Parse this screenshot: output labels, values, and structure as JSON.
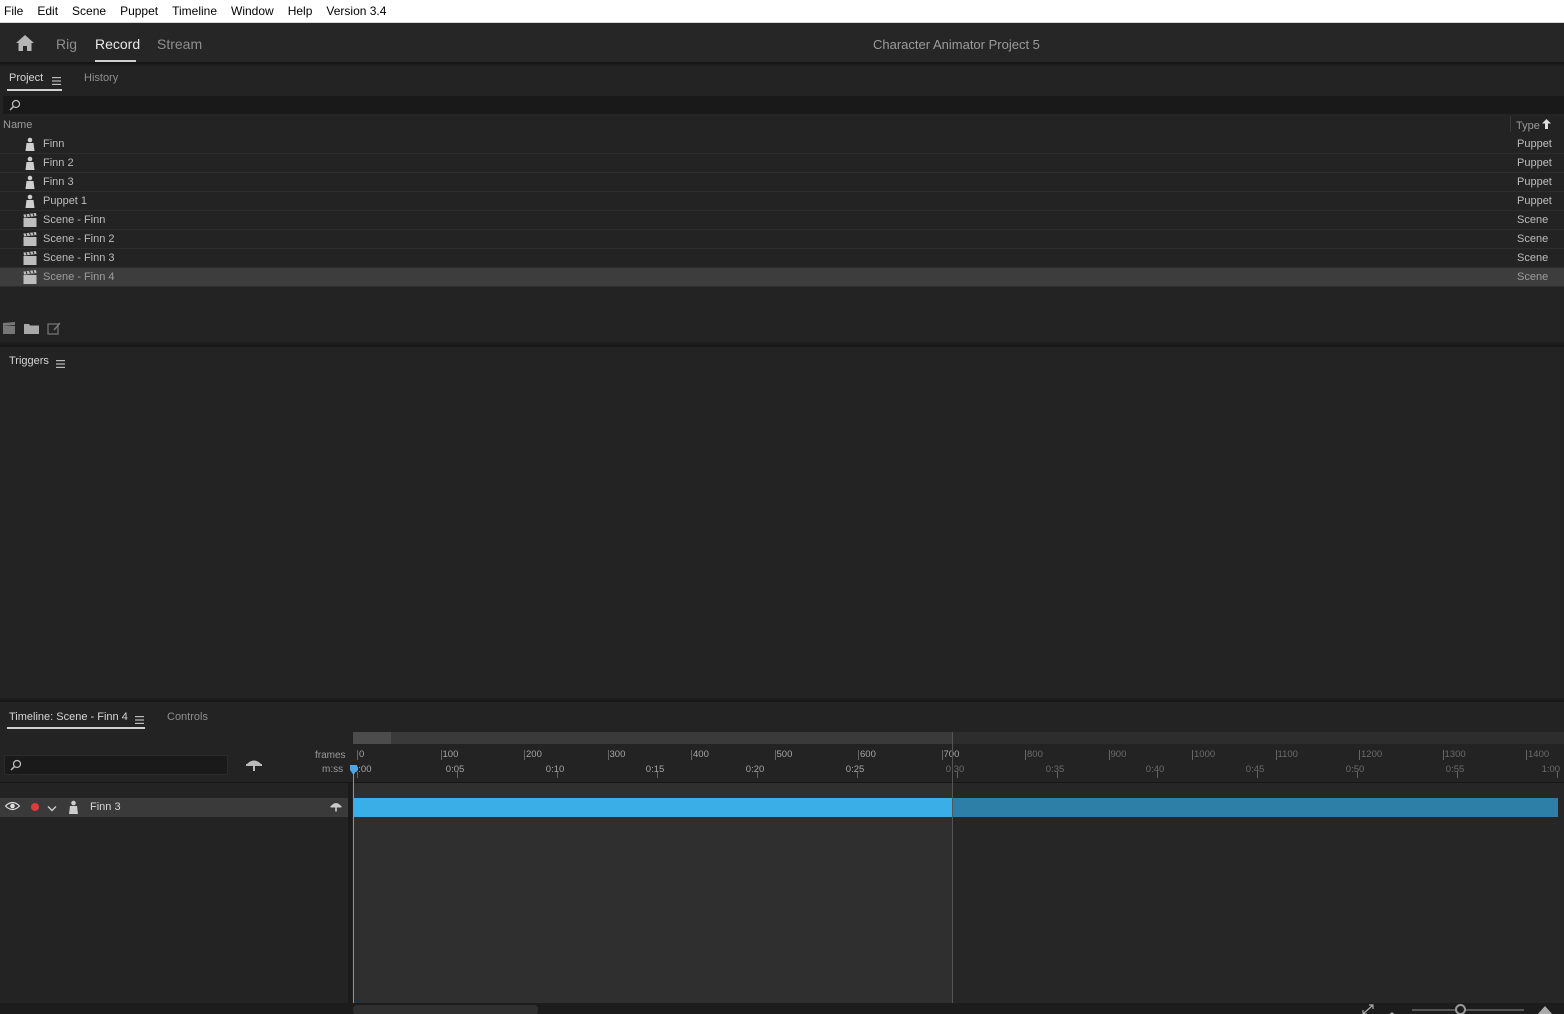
{
  "menubar": {
    "items": [
      "File",
      "Edit",
      "Scene",
      "Puppet",
      "Timeline",
      "Window",
      "Help",
      "Version 3.4"
    ]
  },
  "workspace": {
    "tabs": [
      "Rig",
      "Record",
      "Stream"
    ],
    "active_tab": "Record",
    "project_title": "Character Animator Project 5"
  },
  "project_panel": {
    "tabs": [
      "Project",
      "History"
    ],
    "active_tab": "Project",
    "columns": {
      "name": "Name",
      "type": "Type"
    },
    "sort_indicator": "arrow-up-icon",
    "items": [
      {
        "name": "Finn",
        "type": "Puppet",
        "icon": "puppet-icon"
      },
      {
        "name": "Finn 2",
        "type": "Puppet",
        "icon": "puppet-icon"
      },
      {
        "name": "Finn 3",
        "type": "Puppet",
        "icon": "puppet-icon"
      },
      {
        "name": "Puppet 1",
        "type": "Puppet",
        "icon": "puppet-icon"
      },
      {
        "name": "Scene - Finn",
        "type": "Scene",
        "icon": "scene-icon"
      },
      {
        "name": "Scene - Finn 2",
        "type": "Scene",
        "icon": "scene-icon"
      },
      {
        "name": "Scene - Finn 3",
        "type": "Scene",
        "icon": "scene-icon"
      },
      {
        "name": "Scene - Finn 4",
        "type": "Scene",
        "icon": "scene-icon",
        "selected": true
      }
    ]
  },
  "triggers_panel": {
    "title": "Triggers"
  },
  "timeline_panel": {
    "tab": "Timeline: Scene - Finn 4",
    "controls_tab": "Controls",
    "frames_label": "frames",
    "mss_label": "m:ss",
    "frame_ticks": [
      "0",
      "100",
      "200",
      "300",
      "400",
      "500",
      "600",
      "700",
      "800",
      "900",
      "1000",
      "1100",
      "1200",
      "1300",
      "1400"
    ],
    "time_ticks": [
      "0:00",
      "0:05",
      "0:10",
      "0:15",
      "0:20",
      "0:25",
      "0:30",
      "0:35",
      "0:40",
      "0:45",
      "0:50",
      "0:55",
      "1:00"
    ],
    "track": {
      "name": "Finn 3",
      "armed": true,
      "visible": true
    },
    "colors": {
      "clip": "#3aaee6",
      "clip_outside": "#2d7fa8",
      "playhead": "#4aa6e8",
      "record": "#e03a3a"
    }
  }
}
